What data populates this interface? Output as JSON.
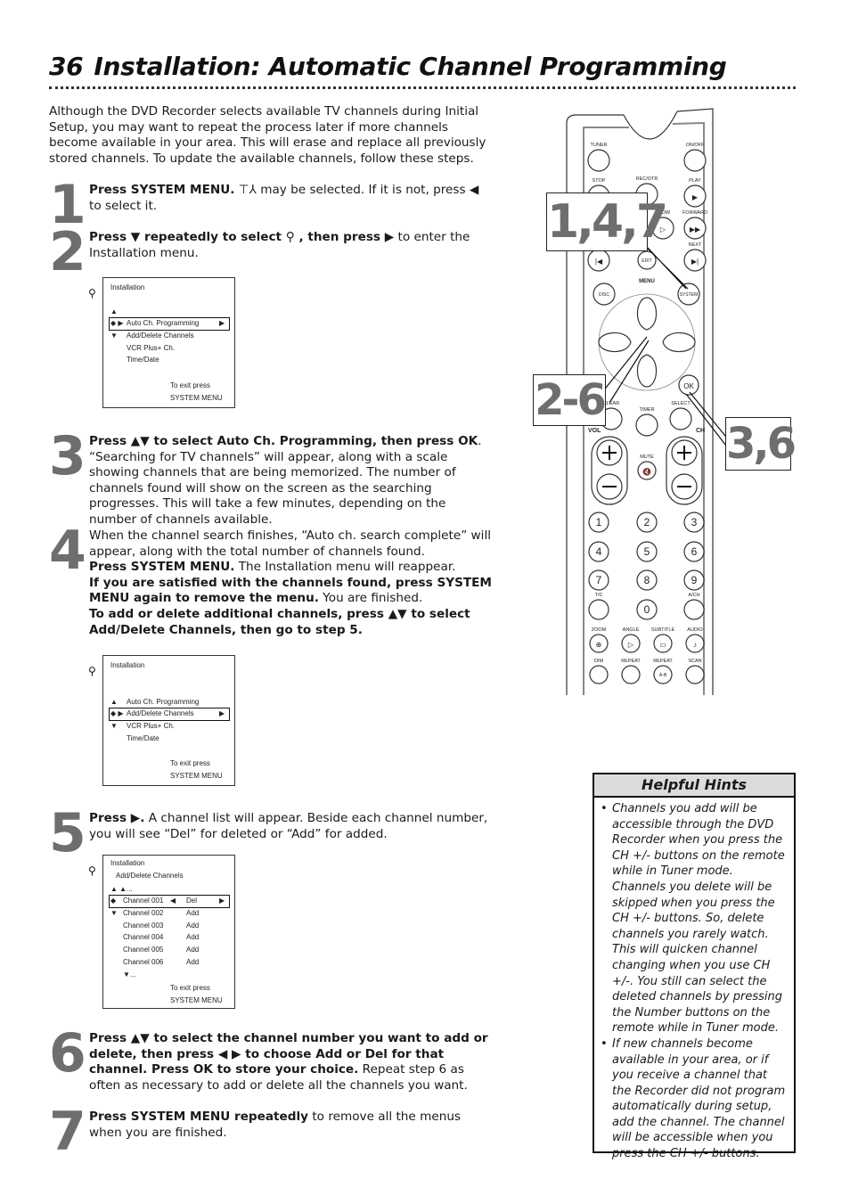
{
  "header": {
    "page_number": "36",
    "title": "Installation: Automatic Channel Programming"
  },
  "intro": "Although the DVD Recorder selects available TV channels during Initial Setup, you may want to repeat the process later if more channels become available in your area. This will erase and replace all previously stored channels. To update the available channels, follow these steps.",
  "steps": [
    {
      "num": "1",
      "bold1": "Press SYSTEM MENU.",
      "text1": " ⊤⅄ may be selected. If it is not, press ◀ to select it."
    },
    {
      "num": "2",
      "bold1": "Press ▼ repeatedly to select ⚲ , then press ▶",
      "text1": " to enter the Installation menu."
    },
    {
      "num": "3",
      "bold1": "Press ▲▼ to select Auto Ch. Programming, then press OK",
      "text1": ". “Searching for TV channels” will appear, along with a scale showing channels that are being memorized. The number of channels found will show on the screen as the searching progresses. This will take a few minutes, depending on the number of channels available."
    },
    {
      "num": "4",
      "text0": "When the channel search finishes, “Auto ch. search complete” will appear, along with the total number of channels found.",
      "bold1": "Press SYSTEM MENU.",
      "text1": " The Installation menu will reappear.",
      "bold2": "If you are satisfied with the channels found, press SYSTEM MENU again to remove the menu.",
      "text2": " You are finished.",
      "bold3": "To add or delete additional channels, press ▲▼ to select Add/Delete Channels, then go to step 5."
    },
    {
      "num": "5",
      "bold1": "Press ▶.",
      "text1": "  A channel list will appear. Beside each channel number, you will see “Del” for deleted or “Add” for added."
    },
    {
      "num": "6",
      "bold1": "Press ▲▼ to select the channel number you want to add or delete, then press ◀ ▶ to choose Add or Del for that channel. Press OK to store your choice.",
      "text1": " Repeat step 6 as often as necessary to add or delete all the channels you want."
    },
    {
      "num": "7",
      "bold1": "Press SYSTEM MENU repeatedly",
      "text1": " to remove all the menus when you are finished."
    }
  ],
  "screen1": {
    "title": "Installation",
    "up": "▲",
    "sel_marker": "◆ ▶",
    "down": "▼",
    "items": [
      "Auto Ch. Programming",
      "Add/Delete Channels",
      "VCR Plus+ Ch.",
      "Time/Date"
    ],
    "arrow": "▶",
    "exit1": "To exit press",
    "exit2": "SYSTEM MENU"
  },
  "screen2": {
    "title": "Installation",
    "up": "▲",
    "sel_marker": "◆ ▶",
    "down": "▼",
    "items": [
      "Auto Ch. Programming",
      "Add/Delete Channels",
      "VCR Plus+ Ch.",
      "Time/Date"
    ],
    "arrow": "▶",
    "exit1": "To exit press",
    "exit2": "SYSTEM MENU"
  },
  "screen3": {
    "title": "Installation",
    "subtitle": "Add/Delete Channels",
    "up": "▲  ▲...",
    "sel_marker": "◆",
    "down": "▼",
    "channels": [
      {
        "label": "Channel  001",
        "status": "Del"
      },
      {
        "label": "Channel  002",
        "status": "Add"
      },
      {
        "label": "Channel  003",
        "status": "Add"
      },
      {
        "label": "Channel  004",
        "status": "Add"
      },
      {
        "label": "Channel  005",
        "status": "Add"
      },
      {
        "label": "Channel  006",
        "status": "Add"
      }
    ],
    "left_arrow": "◀",
    "arrow": "▶",
    "more": "▼...",
    "exit1": "To exit press",
    "exit2": "SYSTEM MENU"
  },
  "remote": {
    "labels": {
      "tuner": "TUNER",
      "onoff": "ON/OFF",
      "stop": "STOP",
      "recotr": "REC/OTR",
      "play": "PLAY",
      "slow": "SLOW",
      "forward": "FORWARD",
      "next": "NEXT",
      "edit": "EDIT",
      "menu": "MENU",
      "disc": "DISC",
      "system": "SYSTEM",
      "ok": "OK",
      "clear": "CLEAR",
      "timer": "TIMER",
      "select": "SELECT",
      "vol": "VOL",
      "ch": "CH",
      "mute": "MUTE",
      "tc": "T/C",
      "ach": "A/CH",
      "zoom": "ZOOM",
      "angle": "ANGLE",
      "subtitle": "SUBTITLE",
      "audio": "AUDIO",
      "dim": "DIM",
      "repeat": "REPEAT",
      "repeat_ab": "REPEAT",
      "scan": "SCAN",
      "ab": "A-B"
    },
    "digits": [
      "1",
      "2",
      "3",
      "4",
      "5",
      "6",
      "7",
      "8",
      "9",
      "0"
    ],
    "callouts": [
      "1,4,7",
      "2-6",
      "3,6"
    ]
  },
  "hints": {
    "title": "Helpful Hints",
    "items": [
      "Channels you add will be accessible through the DVD Recorder when you press the CH +/- buttons on the remote while in Tuner mode. Channels you delete will be skipped when you press the CH +/- buttons. So, delete channels you rarely watch. This will quicken channel changing when you use CH +/-. You still can select the deleted channels by pressing the Number buttons on the remote while in Tuner mode.",
      "If new channels become available in your area, or if you receive a channel that the Recorder did not program automatically during setup, add the channel. The channel will be accessible when you press the CH +/- buttons."
    ]
  }
}
